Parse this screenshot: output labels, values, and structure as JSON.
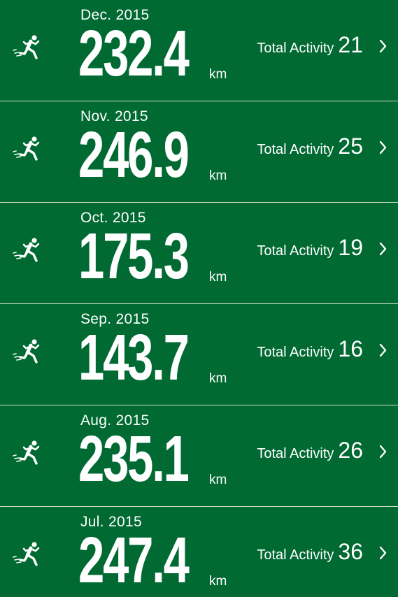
{
  "colors": {
    "background": "#006a32",
    "text": "#ffffff",
    "divider": "#cfe0d4"
  },
  "icons": {
    "row_icon": "runner-icon",
    "row_arrow": "chevron-right-icon"
  },
  "months": [
    {
      "month": "Dec. 2015",
      "distance": "232.4",
      "unit": "km",
      "activity_label": "Total Activity",
      "activity_count": "21"
    },
    {
      "month": "Nov. 2015",
      "distance": "246.9",
      "unit": "km",
      "activity_label": "Total Activity",
      "activity_count": "25"
    },
    {
      "month": "Oct. 2015",
      "distance": "175.3",
      "unit": "km",
      "activity_label": "Total Activity",
      "activity_count": "19"
    },
    {
      "month": "Sep. 2015",
      "distance": "143.7",
      "unit": "km",
      "activity_label": "Total Activity",
      "activity_count": "16"
    },
    {
      "month": "Aug. 2015",
      "distance": "235.1",
      "unit": "km",
      "activity_label": "Total Activity",
      "activity_count": "26"
    },
    {
      "month": "Jul. 2015",
      "distance": "247.4",
      "unit": "km",
      "activity_label": "Total Activity",
      "activity_count": "36"
    }
  ]
}
